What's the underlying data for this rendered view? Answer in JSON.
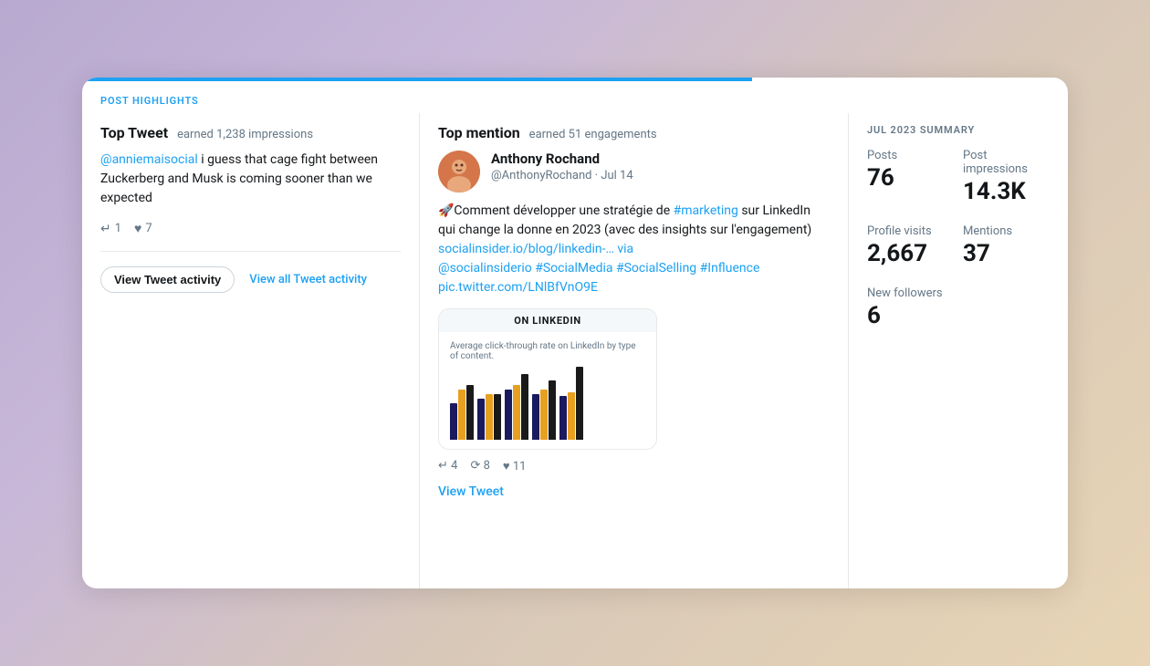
{
  "card": {
    "header": {
      "label": "POST HIGHLIGHTS"
    }
  },
  "left": {
    "section_title": "Top Tweet",
    "section_subtitle": "earned 1,238 impressions",
    "mention": "@anniemaisocial",
    "tweet_text": " i guess that cage fight between Zuckerberg and Musk is coming sooner than we expected",
    "reply_count": "1",
    "like_count": "7",
    "btn_activity": "View Tweet activity",
    "link_all": "View all Tweet activity"
  },
  "middle": {
    "section_title": "Top mention",
    "section_subtitle": "earned 51 engagements",
    "user_name": "Anthony Rochand",
    "handle": "@AnthonyRochand",
    "date": "· Jul 14",
    "body_line1": "🚀Comment développer une stratégie de",
    "hashtag_marketing": "#marketing",
    "body_line2": " sur LinkedIn qui change la donne en 2023 (avec des insights sur l'engagement)",
    "link": "socialinsider.io/blog/linkedin-… via",
    "mention2": "@socialinsiderio",
    "tags": "#SocialMedia #SocialSelling #Influence",
    "pic_link": "pic.twitter.com/LNlBfVnO9E",
    "chart_header": "ON LINKEDIN",
    "chart_label": "Average click-through rate on LinkedIn by type of content.",
    "reply_count": "4",
    "retweet_count": "8",
    "like_count": "11",
    "btn_view_tweet": "View Tweet",
    "bars": [
      {
        "navy": 40,
        "orange": 55,
        "black": 60
      },
      {
        "navy": 45,
        "orange": 50,
        "black": 50
      },
      {
        "navy": 55,
        "orange": 60,
        "black": 72
      },
      {
        "navy": 50,
        "orange": 55,
        "black": 65
      },
      {
        "navy": 48,
        "orange": 52,
        "black": 80
      }
    ]
  },
  "right": {
    "summary_label": "JUL 2023 SUMMARY",
    "stats": [
      {
        "label": "Posts",
        "value": "76"
      },
      {
        "label": "Post impressions",
        "value": "14.3K"
      },
      {
        "label": "Profile visits",
        "value": "2,667"
      },
      {
        "label": "Mentions",
        "value": "37"
      },
      {
        "label": "New followers",
        "value": "6"
      }
    ]
  },
  "icons": {
    "reply": "↵",
    "heart": "♥",
    "retweet": "⟳"
  }
}
